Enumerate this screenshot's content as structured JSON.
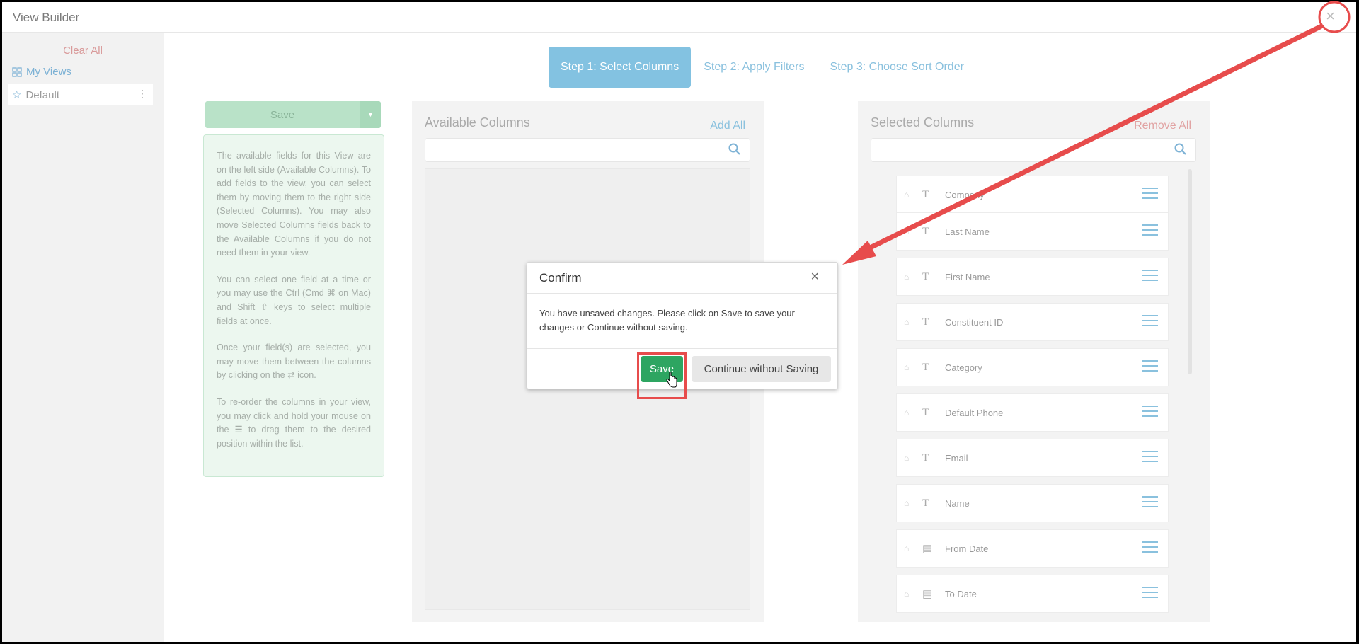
{
  "window": {
    "title": "View Builder",
    "close_glyph": "×"
  },
  "sidebar": {
    "clear_all": "Clear All",
    "my_views": "My Views",
    "default_view": "Default"
  },
  "steps": [
    {
      "label": "Step 1: Select Columns",
      "active": true
    },
    {
      "label": "Step 2: Apply Filters",
      "active": false
    },
    {
      "label": "Step 3: Choose Sort Order",
      "active": false
    }
  ],
  "save_button": {
    "label": "Save"
  },
  "help_text": [
    "The available fields for this View are on the left side (Available Columns). To add fields to the view, you can select them by moving them to the right side (Selected Columns). You may also move Selected Columns fields back to the Available Columns if you do not need them in your view.",
    "You can select one field at a time or you may use the Ctrl (Cmd ⌘ on Mac) and Shift ⇧ keys to select multiple fields at once.",
    "Once your field(s) are selected, you may move them between the columns by clicking on the ⇄ icon.",
    "To re-order the columns in your view, you may click and hold your mouse on the ☰ to drag them to the desired position within the list."
  ],
  "available": {
    "title": "Available Columns",
    "action": "Add All",
    "search_value": ""
  },
  "selected": {
    "title": "Selected Columns",
    "action": "Remove All",
    "search_value": "",
    "columns": [
      {
        "name": "Company",
        "type_icon": "text-type-icon",
        "glyph": "T"
      },
      {
        "name": "Last Name",
        "type_icon": "text-type-icon",
        "glyph": "T"
      },
      {
        "name": "First Name",
        "type_icon": "text-type-icon",
        "glyph": "T"
      },
      {
        "name": "Constituent ID",
        "type_icon": "text-type-icon",
        "glyph": "T"
      },
      {
        "name": "Category",
        "type_icon": "text-type-icon",
        "glyph": "T"
      },
      {
        "name": "Default Phone",
        "type_icon": "text-type-icon",
        "glyph": "T"
      },
      {
        "name": "Email",
        "type_icon": "text-type-icon",
        "glyph": "T"
      },
      {
        "name": "Name",
        "type_icon": "text-type-icon",
        "glyph": "T"
      },
      {
        "name": "From Date",
        "type_icon": "calendar-type-icon",
        "glyph": "▤"
      },
      {
        "name": "To Date",
        "type_icon": "calendar-type-icon",
        "glyph": "▤"
      }
    ]
  },
  "modal": {
    "title": "Confirm",
    "message": "You have unsaved changes. Please click on Save to save your changes or Continue without saving.",
    "save_label": "Save",
    "continue_label": "Continue without Saving"
  },
  "colors": {
    "accent_blue": "#83c2e1",
    "save_green": "#2da561",
    "annotation_red": "#e74c4c"
  }
}
